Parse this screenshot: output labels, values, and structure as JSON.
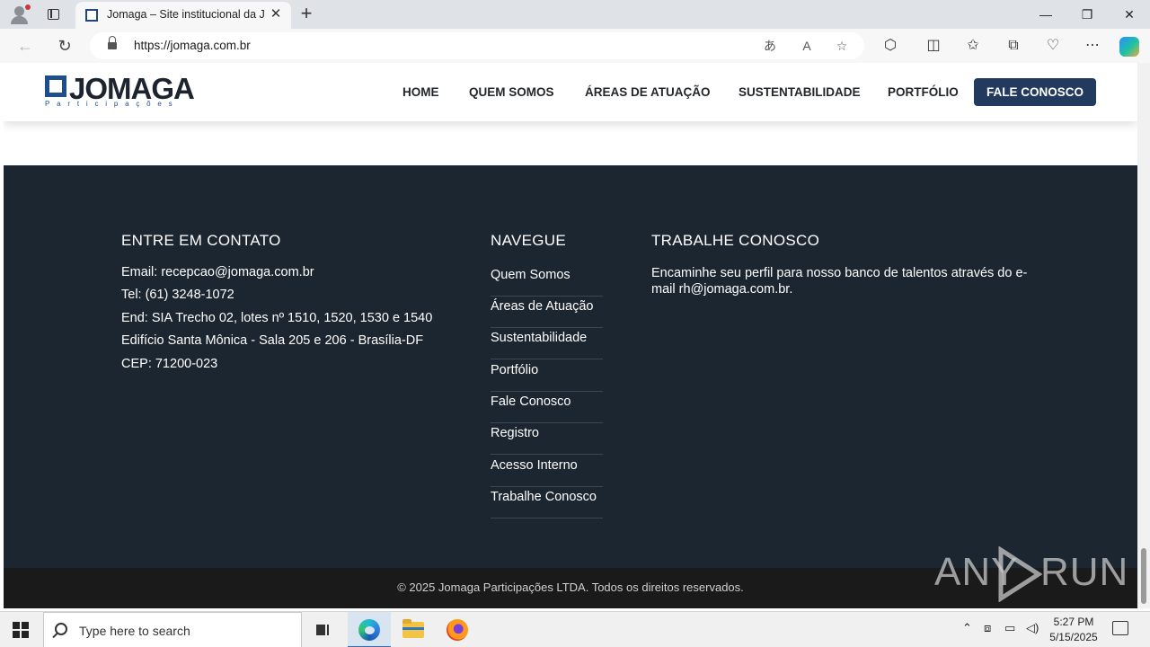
{
  "browser": {
    "tab_title": "Jomaga – Site institucional da Jomaga Participações",
    "url": "https://jomaga.com.br"
  },
  "site": {
    "logo_word": "JOMAGA",
    "logo_sub": "Participações",
    "nav": [
      "HOME",
      "QUEM SOMOS",
      "ÁREAS DE ATUAÇÃO",
      "SUSTENTABILIDADE",
      "PORTFÓLIO"
    ],
    "cta": "FALE CONOSCO"
  },
  "footer": {
    "contact_heading": "ENTRE EM CONTATO",
    "contact_lines": [
      "Email: recepcao@jomaga.com.br",
      "Tel: (61) 3248-1072",
      "End: SIA Trecho 02, lotes nº 1510, 1520, 1530 e 1540",
      "Edifício Santa Mônica - Sala 205 e 206 - Brasília-DF",
      "CEP: 71200-023"
    ],
    "nav_heading": "NAVEGUE",
    "nav_links": [
      "Quem Somos",
      "Áreas de Atuação",
      "Sustentabilidade",
      "Portfólio",
      "Fale Conosco",
      "Registro",
      "Acesso Interno",
      "Trabalhe Conosco"
    ],
    "work_heading": "TRABALHE CONOSCO",
    "work_text": "Encaminhe seu perfil para nosso banco de talentos através do e-mail rh@jomaga.com.br.",
    "copyright": "© 2025 Jomaga Participações LTDA. Todos os direitos reservados."
  },
  "watermark": {
    "left": "ANY",
    "right": "RUN"
  },
  "taskbar": {
    "search_placeholder": "Type here to search",
    "time": "5:27 PM",
    "date": "5/15/2025"
  }
}
